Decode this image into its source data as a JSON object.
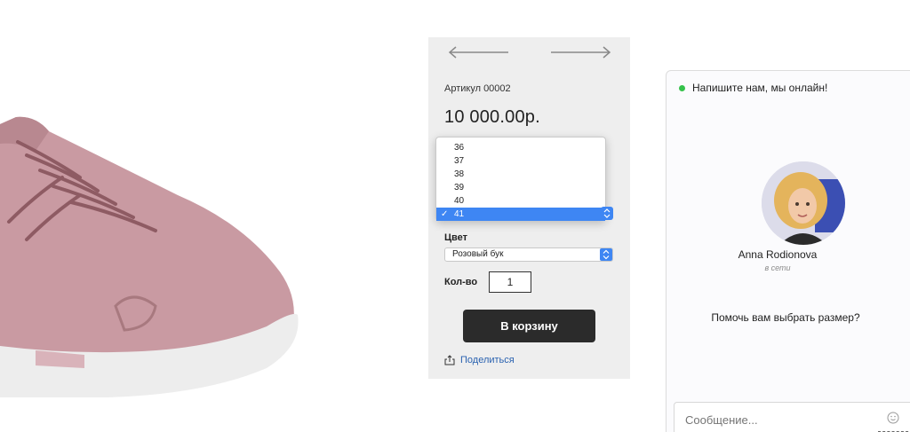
{
  "product": {
    "image_alt": "pink suede sneaker",
    "sku": "Артикул 00002",
    "price": "10 000.00р.",
    "nav": {
      "prev_icon": "arrow-left-icon",
      "next_icon": "arrow-right-icon"
    },
    "sizes": [
      "36",
      "37",
      "38",
      "39",
      "40",
      "41"
    ],
    "selected_size": "41",
    "selected_check": "✓",
    "color_label": "Цвет",
    "color_value": "Розовый бук",
    "qty_label": "Кол-во",
    "qty_value": "1",
    "cart_button": "В корзину",
    "share_label": "Поделиться"
  },
  "chat": {
    "header": "Напишите нам, мы онлайн!",
    "agent_name": "Anna Rodionova",
    "agent_status": "в сети",
    "message": "Помочь вам выбрать размер?",
    "input_placeholder": "Сообщение..."
  },
  "colors": {
    "accent_blue": "#3e86f3",
    "online_green": "#35c24b",
    "cart_button": "#2b2b2b",
    "shoe_pink": "#c99aa2"
  }
}
